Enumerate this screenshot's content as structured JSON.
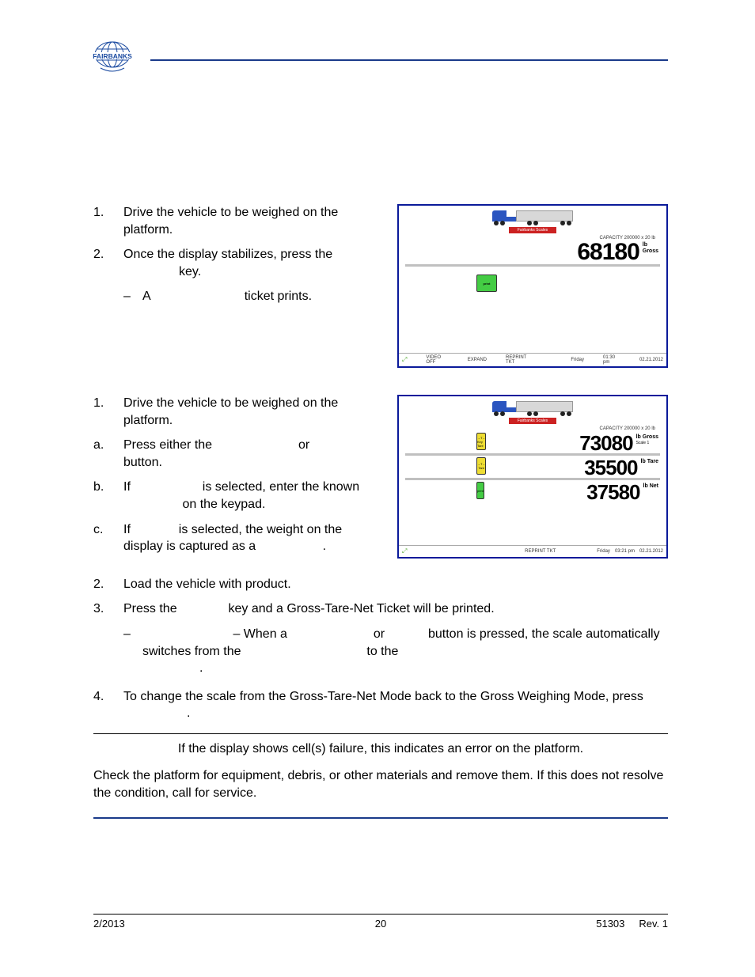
{
  "logo_text": "FAIRBANKS",
  "section1": {
    "items": [
      "Drive the vehicle to be weighed on the platform.",
      "Once the display stabilizes, press the"
    ],
    "key_word": "key.",
    "dash_A": "A",
    "dash_rest": "ticket prints."
  },
  "screenshot1": {
    "capacity": "CAPACITY 200000 x 20 lb",
    "reading": "68180",
    "unit_lb": "lb",
    "unit_label": "Gross",
    "redbar": "Fairbanks Scales",
    "footer": {
      "video": "VIDEO OFF",
      "expand": "EXPAND",
      "reprint": "REPRINT TKT",
      "day": "Friday",
      "time": "01:30 pm",
      "date": "02.21.2012"
    }
  },
  "section2": {
    "items": {
      "1": "Drive the vehicle to be weighed on the platform.",
      "a_pre": "Press either the",
      "a_or": "or",
      "a_post": "button.",
      "b_pre": "If",
      "b_mid": "is selected, enter the known",
      "b_post": "on the keypad.",
      "c_pre": "If",
      "c_mid": "is selected, the weight on the display is captured as a",
      "c_period": ".",
      "2": "Load the vehicle with product.",
      "3_pre": "Press the",
      "3_post": "key and a Gross-Tare-Net Ticket will be printed.",
      "3_dash_lead": "– When a",
      "3_dash_or": "or",
      "3_dash_mid": "button is pressed, the scale automatically switches from the",
      "3_dash_to": "to the",
      "3_dash_period": ".",
      "4_pre": "To change the scale from the Gross-Tare-Net Mode back to the Gross Weighing Mode, press",
      "4_period": "."
    }
  },
  "screenshot2": {
    "capacity": "CAPACITY 200000 x 20 lb",
    "redbar": "Fairbanks Scales",
    "rows": [
      {
        "btn": "Key Tare",
        "val": "73080",
        "lb": "lb",
        "label": "Gross",
        "sub": "Scale 1"
      },
      {
        "btn": "Tare",
        "val": "35500",
        "lb": "lb",
        "label": "Tare",
        "sub": ""
      },
      {
        "btn": "print",
        "val": "37580",
        "lb": "lb",
        "label": "Net",
        "sub": ""
      }
    ],
    "footer": {
      "reprint": "REPRINT TKT",
      "day": "Friday",
      "time": "03:21 pm",
      "date": "02.21.2012"
    }
  },
  "note": {
    "line1": "If the display shows cell(s) failure, this indicates an error on the platform.",
    "body": "Check the platform for equipment, debris, or other materials and remove them.  If this does not resolve the condition, call for service."
  },
  "footer": {
    "left": "2/2013",
    "center": "20",
    "right_a": "51303",
    "right_b": "Rev. 1"
  }
}
